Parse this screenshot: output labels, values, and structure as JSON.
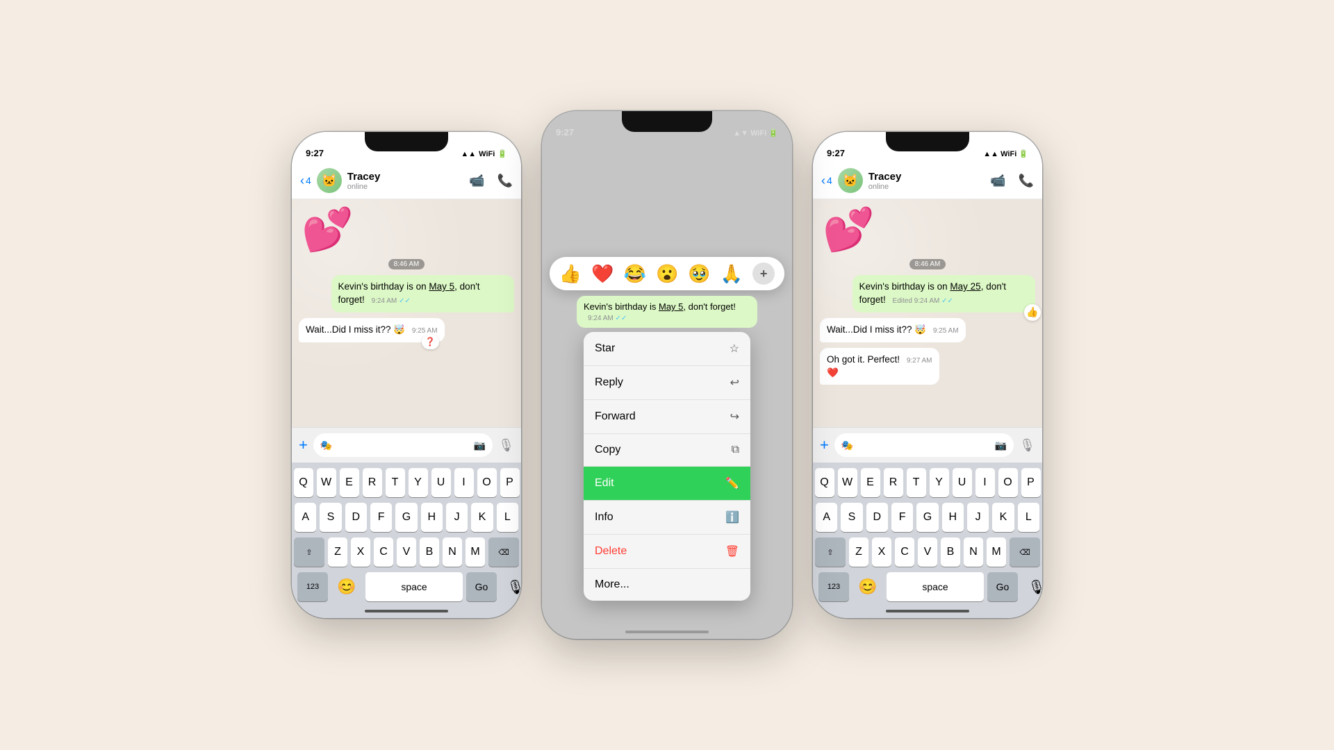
{
  "bg": "#f5ede3",
  "phones": {
    "left": {
      "time": "9:27",
      "status_icons": "▲ ▼ ◀ ▶",
      "back_count": "4",
      "contact_name": "Tracey",
      "contact_status": "online",
      "sticker_emoji": "🩷",
      "time_stamp_center": "8:46 AM",
      "msg1_text": "Kevin's birthday is  on May 5, don't forget!",
      "msg1_time": "9:24 AM",
      "msg1_underline": "May 5",
      "msg2_text": "Wait...Did I miss it??",
      "msg2_emoji": "🤯",
      "msg2_time": "9:25 AM",
      "msg2_reaction": "❓",
      "input_placeholder": "",
      "kb_row1": [
        "Q",
        "W",
        "E",
        "R",
        "T",
        "Y",
        "U",
        "I",
        "O",
        "P"
      ],
      "kb_row2": [
        "A",
        "S",
        "D",
        "F",
        "G",
        "H",
        "J",
        "K",
        "L"
      ],
      "kb_row3": [
        "Z",
        "X",
        "C",
        "V",
        "B",
        "N",
        "M"
      ],
      "kb_123": "123",
      "kb_space": "space",
      "kb_go": "Go"
    },
    "middle": {
      "time": "9:27",
      "emojis": [
        "👍",
        "❤️",
        "😂",
        "😮",
        "🥹",
        "🙏"
      ],
      "plus_label": "+",
      "msg_text": "Kevin's birthday is ",
      "msg_underline": "May 5",
      "msg_suffix": ", don't forget!",
      "msg_time": "9:24 AM",
      "menu_items": [
        {
          "label": "Star",
          "icon": "☆"
        },
        {
          "label": "Reply",
          "icon": "↩"
        },
        {
          "label": "Forward",
          "icon": "↪"
        },
        {
          "label": "Copy",
          "icon": "⧉"
        },
        {
          "label": "Edit",
          "icon": "✏️"
        },
        {
          "label": "Info",
          "icon": "ℹ️"
        },
        {
          "label": "Delete",
          "icon": "🗑️"
        },
        {
          "label": "More...",
          "icon": ""
        }
      ]
    },
    "right": {
      "time": "9:27",
      "back_count": "4",
      "contact_name": "Tracey",
      "contact_status": "online",
      "time_stamp_center": "8:46 AM",
      "msg1_edited": "Edited 9:24 AM",
      "msg1_text": "Kevin's birthday is  on May 25, don't forget!",
      "msg1_underline": "May 25",
      "msg2_text": "Wait...Did I miss it??",
      "msg2_emoji": "🤯",
      "msg2_time": "9:25 AM",
      "msg3_text": "Oh got it. Perfect!",
      "msg3_time": "9:27 AM",
      "msg3_emoji": "❤️",
      "thumbs_reaction": "👍",
      "kb_123": "123",
      "kb_space": "space",
      "kb_go": "Go"
    }
  }
}
